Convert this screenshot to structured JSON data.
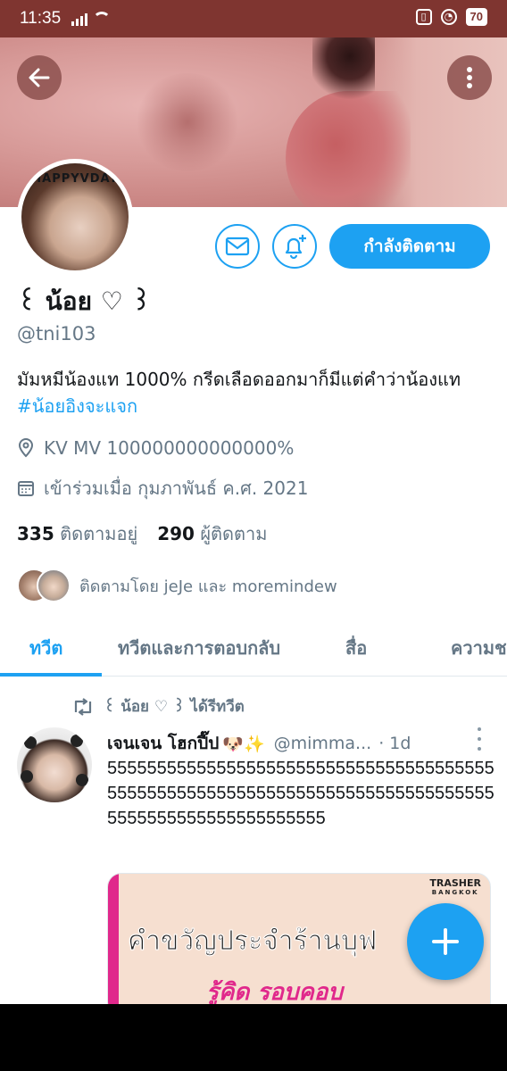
{
  "status_bar": {
    "time": "11:35",
    "battery": "70"
  },
  "profile": {
    "name": "꒰ น้อย ♡ ꒱",
    "handle": "@tni103",
    "bio_text": "มัมหมีน้องแท 1000% กรีดเลือดออกมาก็มีแต่คำว่าน้องแท ",
    "bio_hashtag": "#น้อยอิงจะแจก",
    "location": "KV MV 100000000000000%",
    "joined": "เข้าร่วมเมื่อ กุมภาพันธ์ ค.ศ. 2021",
    "following_count": "335",
    "following_label": "ติดตามอยู่",
    "followers_count": "290",
    "followers_label": "ผู้ติดตาม",
    "followed_by": "ติดตามโดย jeJe และ moremindew",
    "follow_button": "กำลังติดตาม",
    "avatar_text": "HAPPYVDAY"
  },
  "tabs": [
    {
      "label": "ทวีต",
      "active": true
    },
    {
      "label": "ทวีตและการตอบกลับ",
      "active": false
    },
    {
      "label": "สื่อ",
      "active": false
    },
    {
      "label": "ความช",
      "active": false
    }
  ],
  "tweet": {
    "retweet_label": "꒰ น้อย ♡ ꒱ ได้รีทวีต",
    "author_name": "เจนเจน โฮกปี๊ป",
    "author_emoji": "🐶✨",
    "author_handle": "@mimma...",
    "time": "· 1d",
    "text": "5555555555555555555555555555555555555555555555555555555555555555555555555555555555555555555555555555",
    "media": {
      "brand": "TRASHER",
      "brand_sub": "BANGKOK",
      "line1": "คำขวัญประจำร้านบุฟ",
      "line2": "รู้คิด  รอบคอบ"
    }
  },
  "colors": {
    "accent": "#1da1f2",
    "status_bar": "#7f3530",
    "muted": "#657786"
  }
}
